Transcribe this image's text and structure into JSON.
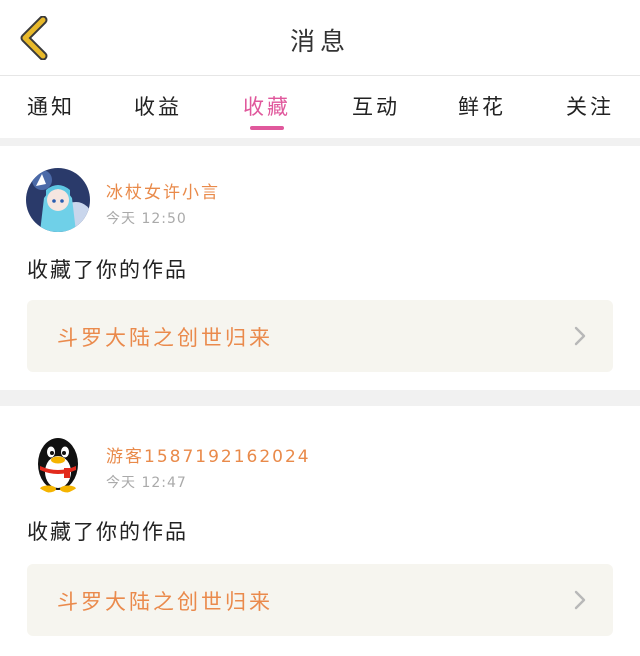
{
  "header": {
    "title": "消息",
    "back_icon": "chevron-left-icon"
  },
  "tabs": [
    {
      "label": "通知",
      "active": false
    },
    {
      "label": "收益",
      "active": false
    },
    {
      "label": "收藏",
      "active": true
    },
    {
      "label": "互动",
      "active": false
    },
    {
      "label": "鲜花",
      "active": false
    },
    {
      "label": "关注",
      "active": false
    }
  ],
  "colors": {
    "accent": "#e0589c",
    "username": "#e98a4a",
    "work_title": "#ea8a4c",
    "work_box_bg": "#f6f5ef",
    "back_icon": "#e8b92a"
  },
  "notifications": [
    {
      "username": "冰杖女许小言",
      "time": "今天 12:50",
      "action": "收藏了你的作品",
      "work_title": "斗罗大陆之创世归来",
      "avatar_icon": "anime-girl-avatar"
    },
    {
      "username": "游客1587192162024",
      "time": "今天 12:47",
      "action": "收藏了你的作品",
      "work_title": "斗罗大陆之创世归来",
      "avatar_icon": "penguin-avatar"
    }
  ]
}
